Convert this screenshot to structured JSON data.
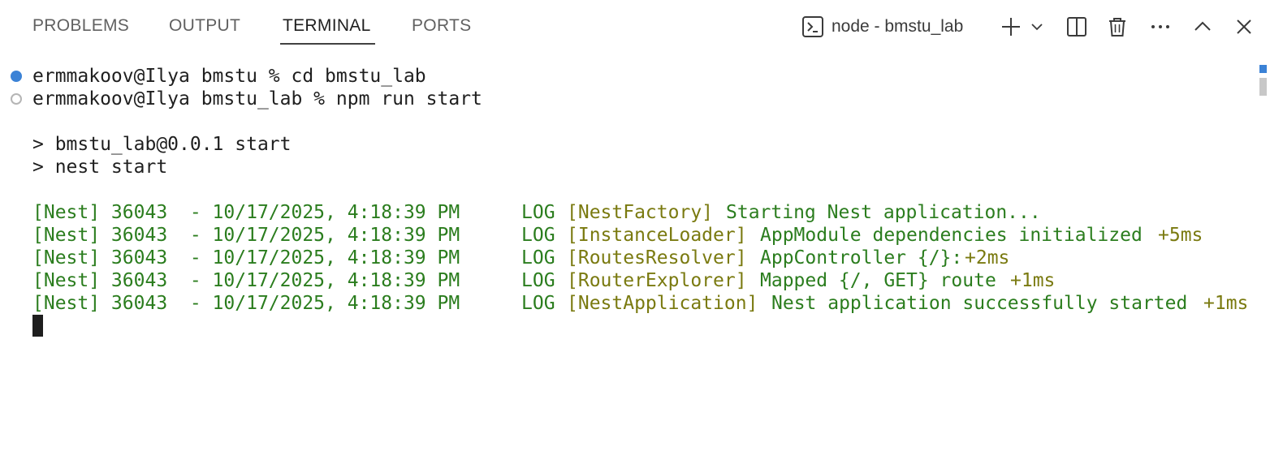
{
  "tabs": [
    {
      "label": "PROBLEMS",
      "active": false
    },
    {
      "label": "OUTPUT",
      "active": false
    },
    {
      "label": "TERMINAL",
      "active": true
    },
    {
      "label": "PORTS",
      "active": false
    }
  ],
  "actions": {
    "terminal_icon": "terminal-icon",
    "terminal_name": "node - bmstu_lab",
    "new_terminal_icon": "plus-icon",
    "dropdown_icon": "chevron-down-icon",
    "split_icon": "split-editor-icon",
    "kill_icon": "trash-icon",
    "more_icon": "ellipsis-icon",
    "maximize_icon": "chevron-up-icon",
    "close_icon": "close-icon"
  },
  "terminal": {
    "prompt1": "ermmakoov@Ilya bmstu % cd bmstu_lab",
    "prompt2": "ermmakoov@Ilya bmstu_lab % npm run start",
    "script1": "> bmstu_lab@0.0.1 start",
    "script2": "> nest start",
    "logs": [
      {
        "prefix": "[Nest] 36043  - 10/17/2025, 4:18:39 PM",
        "level": "LOG",
        "context": "[NestFactory]",
        "message": "Starting Nest application...",
        "timing": ""
      },
      {
        "prefix": "[Nest] 36043  - 10/17/2025, 4:18:39 PM",
        "level": "LOG",
        "context": "[InstanceLoader]",
        "message": "AppModule dependencies initialized",
        "timing": "+5ms"
      },
      {
        "prefix": "[Nest] 36043  - 10/17/2025, 4:18:39 PM",
        "level": "LOG",
        "context": "[RoutesResolver]",
        "message": "AppController {/}:",
        "timing": "+2ms"
      },
      {
        "prefix": "[Nest] 36043  - 10/17/2025, 4:18:39 PM",
        "level": "LOG",
        "context": "[RouterExplorer]",
        "message": "Mapped {/, GET} route",
        "timing": "+1ms"
      },
      {
        "prefix": "[Nest] 36043  - 10/17/2025, 4:18:39 PM",
        "level": "LOG",
        "context": "[NestApplication]",
        "message": "Nest application successfully started",
        "timing": "+1ms"
      }
    ]
  },
  "colors": {
    "log_green": "#2b7d1e",
    "log_olive": "#7a7a10",
    "decoration_blue": "#3b82d6"
  }
}
